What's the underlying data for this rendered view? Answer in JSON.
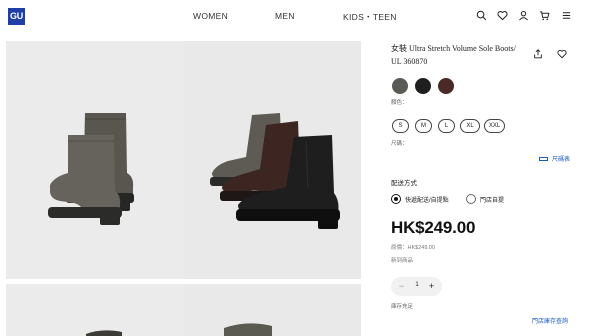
{
  "header": {
    "logo_text": "GU",
    "nav": [
      "WOMEN",
      "MEN",
      "KIDS・TEEN"
    ],
    "icons": [
      "search-icon",
      "heart-icon",
      "user-icon",
      "cart-icon",
      "menu-icon"
    ]
  },
  "gallery": {
    "images": [
      "boots-pair-side-view",
      "boots-color-lineup",
      "boots-detail-1",
      "boots-detail-2"
    ]
  },
  "product": {
    "title": "女裝 Ultra Stretch Volume Sole Boots/ UL 360870",
    "actions": [
      "share-icon",
      "heart-icon"
    ],
    "colors": [
      {
        "name": "olive-gray",
        "hex": "#5b5a55"
      },
      {
        "name": "black",
        "hex": "#1f1f1f"
      },
      {
        "name": "dark-brown",
        "hex": "#4a2a26"
      }
    ],
    "color_label": "顏色：",
    "sizes": [
      "S",
      "M",
      "L",
      "XL",
      "XXL"
    ],
    "size_label": "尺碼：",
    "size_chart": "尺碼表",
    "delivery": {
      "label": "配送方式",
      "options": [
        "快遞配送/自提點",
        "門店自提"
      ],
      "selected": 0
    },
    "price": "HK$249.00",
    "original_price": "原價：HK$249.00",
    "new_item": "新到商品",
    "quantity": "1",
    "stock_status": "庫存充足",
    "store_stock_link": "門店庫存查詢"
  }
}
